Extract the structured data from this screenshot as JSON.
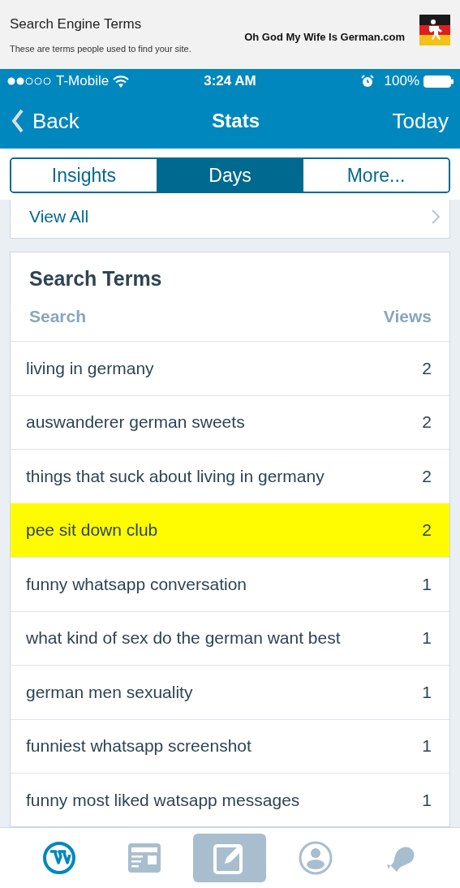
{
  "page_header": {
    "title": "Search Engine Terms",
    "subtitle": "These are terms people used to find your site.",
    "site_name": "Oh God My Wife Is German.com"
  },
  "status_bar": {
    "carrier": "T-Mobile",
    "time": "3:24 AM",
    "battery": "100%"
  },
  "nav_bar": {
    "back": "Back",
    "title": "Stats",
    "action": "Today"
  },
  "segments": [
    {
      "label": "Insights",
      "selected": false
    },
    {
      "label": "Days",
      "selected": true
    },
    {
      "label": "More...",
      "selected": false
    }
  ],
  "previous_card": {
    "link": "View All"
  },
  "search_terms": {
    "title": "Search Terms",
    "columns": [
      "Search",
      "Views"
    ],
    "rows": [
      {
        "term": "living in germany",
        "views": "2",
        "highlighted": false
      },
      {
        "term": "auswanderer german sweets",
        "views": "2",
        "highlighted": false
      },
      {
        "term": "things that suck about living in germany",
        "views": "2",
        "highlighted": false
      },
      {
        "term": "pee sit down club",
        "views": "2",
        "highlighted": true
      },
      {
        "term": "funny whatsapp conversation",
        "views": "1",
        "highlighted": false
      },
      {
        "term": "what kind of sex do the german want best",
        "views": "1",
        "highlighted": false
      },
      {
        "term": "german men sexuality",
        "views": "1",
        "highlighted": false
      },
      {
        "term": "funniest whatsapp screenshot",
        "views": "1",
        "highlighted": false
      },
      {
        "term": "funny most liked watsapp messages",
        "views": "1",
        "highlighted": false
      }
    ]
  },
  "tab_bar": [
    {
      "kind": "site",
      "selected": true
    },
    {
      "kind": "reader",
      "selected": false
    },
    {
      "kind": "write",
      "selected": false
    },
    {
      "kind": "me",
      "selected": false
    },
    {
      "kind": "notifications",
      "selected": false
    }
  ]
}
